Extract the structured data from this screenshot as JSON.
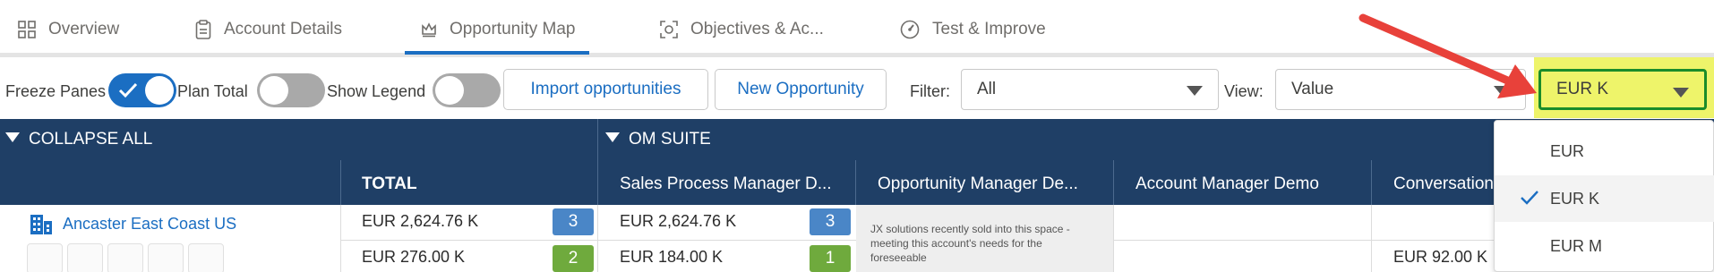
{
  "tabs": [
    {
      "label": "Overview",
      "icon": "grid-icon"
    },
    {
      "label": "Account Details",
      "icon": "clipboard-icon"
    },
    {
      "label": "Opportunity Map",
      "icon": "crown-icon",
      "active": true
    },
    {
      "label": "Objectives & Ac...",
      "icon": "target-icon"
    },
    {
      "label": "Test & Improve",
      "icon": "gauge-icon"
    }
  ],
  "toolbar": {
    "freeze_panes_label": "Freeze Panes",
    "freeze_panes_on": true,
    "plan_total_label": "Plan Total",
    "plan_total_on": false,
    "show_legend_label": "Show Legend",
    "show_legend_on": false,
    "import_button": "Import opportunities",
    "new_opportunity_button": "New Opportunity",
    "filter_label": "Filter:",
    "filter_value": "All",
    "view_label": "View:",
    "view_value": "Value",
    "currency_value": "EUR K"
  },
  "table": {
    "collapse_all": "COLLAPSE ALL",
    "group_name": "OM SUITE",
    "columns": [
      "TOTAL",
      "Sales Process Manager D...",
      "Opportunity Manager De...",
      "Account Manager Demo",
      "Conversation"
    ],
    "account_name": "Ancaster East Coast US",
    "rows": [
      {
        "total": "EUR 2,624.76 K",
        "total_badge": "3",
        "spm": "EUR 2,624.76 K",
        "spm_badge": "3"
      },
      {
        "total": "EUR 276.00 K",
        "total_badge": "2",
        "spm": "EUR 184.00 K",
        "spm_badge": "1",
        "conversation": "EUR 92.00 K"
      }
    ],
    "note": "JX solutions recently sold into this space - meeting this account's needs for the foreseeable"
  },
  "currency_dropdown": {
    "options": [
      "EUR",
      "EUR K",
      "EUR M"
    ],
    "selected": "EUR K"
  },
  "colors": {
    "accent": "#1b6ec2",
    "header_bg": "#1f3f66",
    "highlight": "#eef46a",
    "arrow": "#e8413a"
  }
}
